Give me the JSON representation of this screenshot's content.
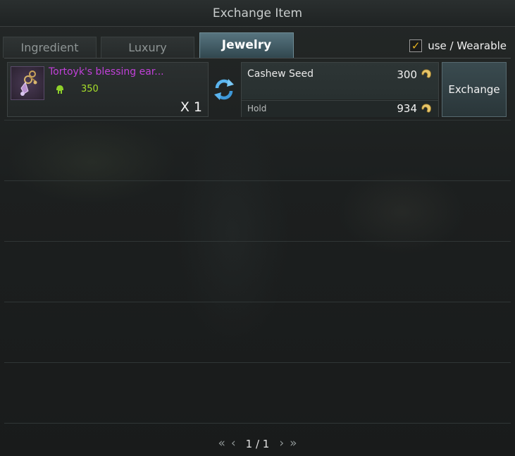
{
  "window": {
    "title": "Exchange Item"
  },
  "tabs": [
    {
      "label": "Ingredient",
      "active": false
    },
    {
      "label": "Luxury",
      "active": false
    },
    {
      "label": "Jewelry",
      "active": true
    }
  ],
  "filter": {
    "label": "use / Wearable",
    "checked": true,
    "check_color": "#e7b421"
  },
  "rows": [
    {
      "item": {
        "name": "Tortoyk's blessing ear...",
        "name_color": "#c040d8",
        "stat_icon": "helmet-icon",
        "stat_value": "350",
        "quantity": "X 1"
      },
      "swap_icon": "swap-arrows-icon",
      "cost": {
        "currency_name": "Cashew Seed",
        "price": "300",
        "currency_icon": "cashew-seed-icon",
        "hold_label": "Hold",
        "hold_value": "934"
      },
      "action": "Exchange"
    }
  ],
  "pagination": {
    "first_icon": "double-chevron-left-icon",
    "prev_icon": "chevron-left-icon",
    "text": "1 / 1",
    "next_icon": "chevron-right-icon",
    "last_icon": "double-chevron-right-icon"
  }
}
